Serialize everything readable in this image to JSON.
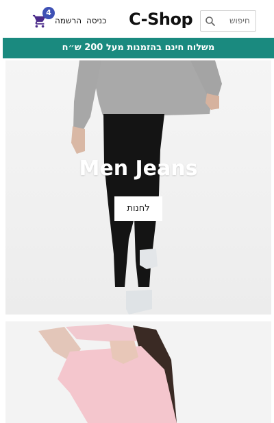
{
  "header": {
    "logo": "C-Shop",
    "search_placeholder": "חיפוש",
    "login_label": "כניסה",
    "register_label": "הרשמה",
    "cart_count": "4"
  },
  "promo": {
    "text": "משלוח חינם בהזמנות מעל 200 ש״ח"
  },
  "hero": {
    "title": "Men Jeans",
    "button_label": "לחנות"
  },
  "colors": {
    "promo_bg": "#1a8a7f",
    "cart_icon": "#4a2a8a",
    "badge_bg": "#3f51b5"
  },
  "icons": [
    "search-icon",
    "cart-icon"
  ]
}
